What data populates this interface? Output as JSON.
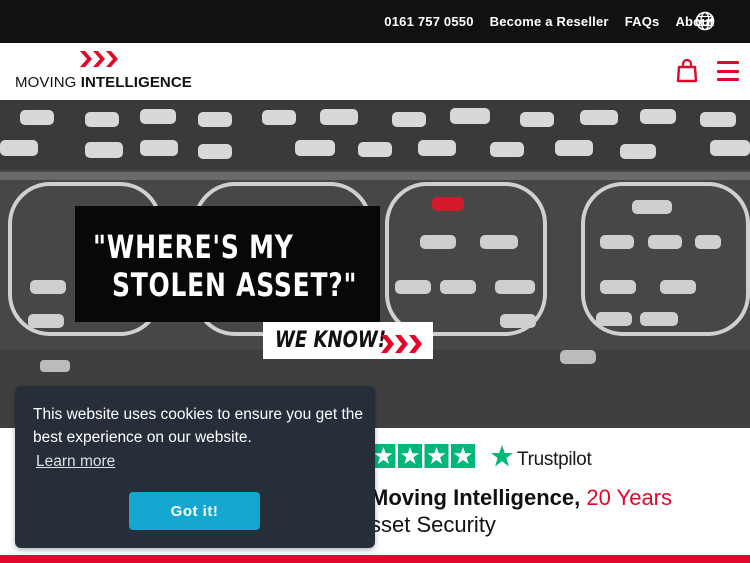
{
  "topbar": {
    "phone": "0161 757 0550",
    "links": [
      "Become a Reseller",
      "FAQs",
      "About"
    ],
    "language_icon": "globe-icon"
  },
  "header": {
    "logo_light": "MOVING ",
    "logo_bold": "INTELLIGENCE",
    "cart_icon": "shopping-bag-icon",
    "menu_icon": "hamburger-icon",
    "accent_color": "#e1082c"
  },
  "hero": {
    "quote_line1": "\"WHERE'S MY",
    "quote_line2": "  STOLEN ASSET?\"",
    "tagline": "WE KNOW!"
  },
  "trust": {
    "rating_stars": 5,
    "star_color": "#00b67a",
    "brand": "Trustpilot",
    "headline_bold": "Moving Intelligence",
    "headline_sep": ", ",
    "headline_red": "20 Years",
    "headline_line2": "sset Security"
  },
  "cookie": {
    "message": "This website uses cookies to ensure you get the best experience on our website.",
    "learn_more": "Learn more",
    "accept": "Got it!",
    "bg_color": "#252e39",
    "button_color": "#14a7d0"
  }
}
